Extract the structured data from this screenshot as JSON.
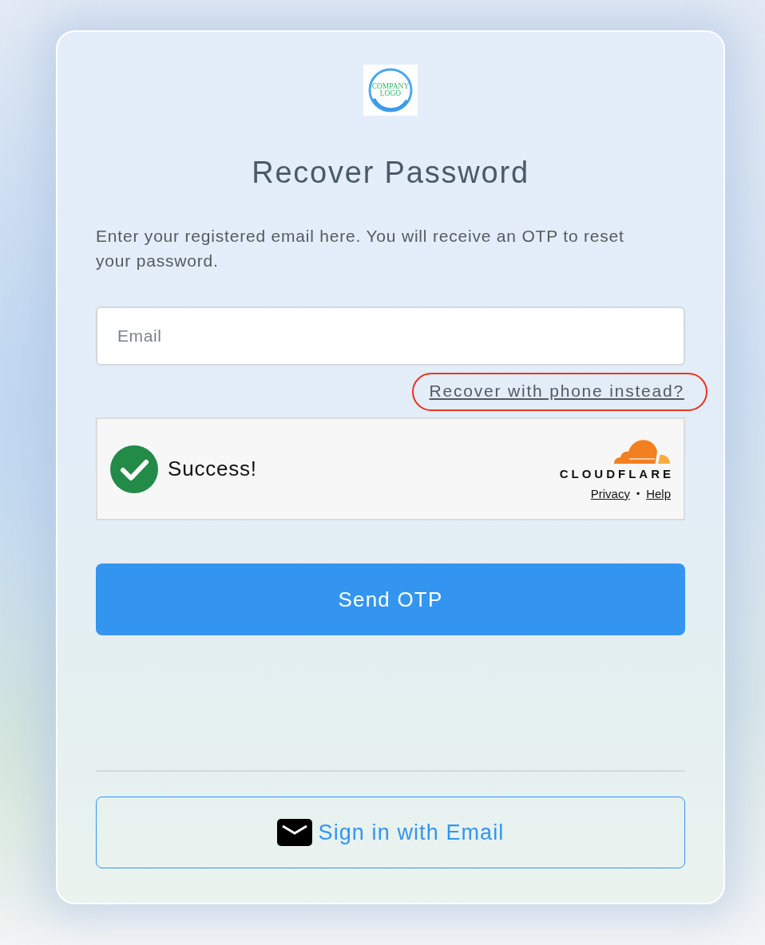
{
  "logo": {
    "text": "COMPANY LOGO"
  },
  "title": "Recover Password",
  "description": "Enter your registered email here. You will receive an OTP to reset your password.",
  "email_field": {
    "placeholder": "Email"
  },
  "alt_link": {
    "label": "Recover with phone instead?",
    "highlighted": true
  },
  "captcha": {
    "status": "Success!",
    "verified": true,
    "brand": "CLOUDFLARE",
    "links": [
      "Privacy",
      "Help"
    ],
    "separator": "•"
  },
  "primary_button": {
    "label": "Send OTP"
  },
  "secondary_button": {
    "label": "Sign in with Email"
  }
}
